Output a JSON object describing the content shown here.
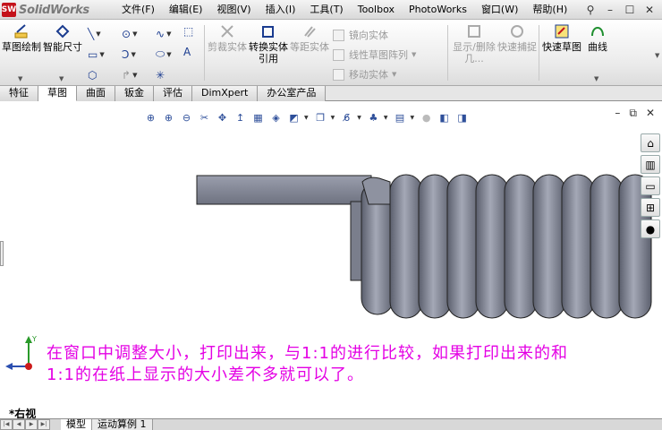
{
  "app": {
    "name": "SolidWorks",
    "logo_mark": "SW"
  },
  "menubar": {
    "items": [
      {
        "label": "文件(F)"
      },
      {
        "label": "编辑(E)"
      },
      {
        "label": "视图(V)"
      },
      {
        "label": "插入(I)"
      },
      {
        "label": "工具(T)"
      },
      {
        "label": "Toolbox"
      },
      {
        "label": "PhotoWorks"
      },
      {
        "label": "窗口(W)"
      },
      {
        "label": "帮助(H)"
      }
    ]
  },
  "ribbon": {
    "sketch": "草图绘制",
    "smart_dimension": "智能尺寸",
    "trim_entities": "剪裁实体",
    "convert_entities": "转换实体引用",
    "offset_entities": "等距实体",
    "mirror_entities": "镜向实体",
    "linear_pattern": "线性草图阵列",
    "move_entities": "移动实体",
    "display_delete_relations": "显示/删除几...",
    "quick_snaps": "快速捕捉",
    "rapid_sketch": "快速草图",
    "curves": "曲线"
  },
  "tabs": [
    {
      "label": "特征",
      "active": false
    },
    {
      "label": "草图",
      "active": true
    },
    {
      "label": "曲面",
      "active": false
    },
    {
      "label": "钣金",
      "active": false
    },
    {
      "label": "评估",
      "active": false
    },
    {
      "label": "DimXpert",
      "active": false
    },
    {
      "label": "办公室产品",
      "active": false
    }
  ],
  "graphics": {
    "annotation": "在窗口中调整大小，打印出来，与1:1的进行比较，如果打印出来的和1:1的在纸上显示的大小差不多就可以了。",
    "view_label": "*右视",
    "triad_axes": {
      "y": "Y",
      "x": "X"
    }
  },
  "bottom_tabs": [
    {
      "label": "模型",
      "active": true
    },
    {
      "label": "运动算例 1",
      "active": false
    }
  ],
  "colors": {
    "annotation": "#e400e4",
    "spring": "#7d8190"
  }
}
